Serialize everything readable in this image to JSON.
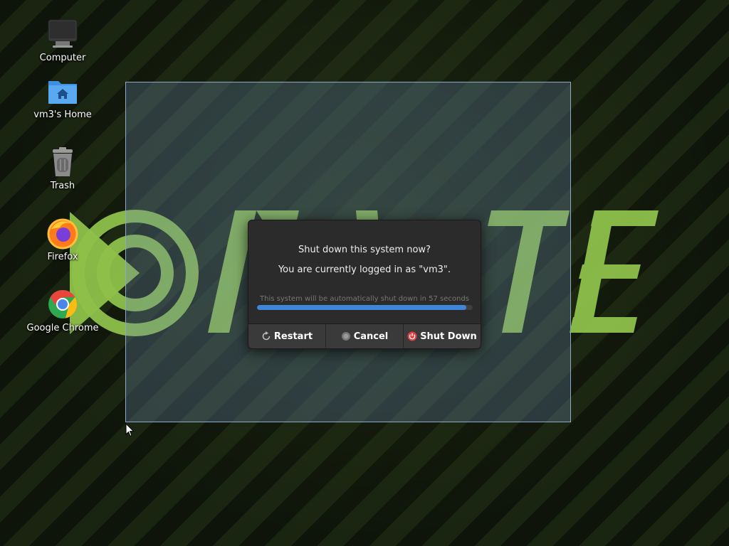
{
  "desktop": {
    "icons": [
      {
        "label": "Computer",
        "icon": "computer-icon"
      },
      {
        "label": "vm3's Home",
        "icon": "home-folder-icon"
      },
      {
        "label": "Trash",
        "icon": "trash-icon"
      },
      {
        "label": "Firefox",
        "icon": "firefox-icon"
      },
      {
        "label": "Google Chrome",
        "icon": "chrome-icon"
      }
    ],
    "wallpaper_color": "#8ec04a"
  },
  "dialog": {
    "question": "Shut down this system now?",
    "logged_in": "You are currently logged in as \"vm3\".",
    "countdown": "This system will be automatically shut down in 57 seconds",
    "progress": 0.97,
    "buttons": {
      "restart": "Restart",
      "cancel": "Cancel",
      "shutdown": "Shut Down"
    },
    "colors": {
      "progress": "#3d86d8",
      "shutdown_icon": "#e03c3c"
    }
  }
}
